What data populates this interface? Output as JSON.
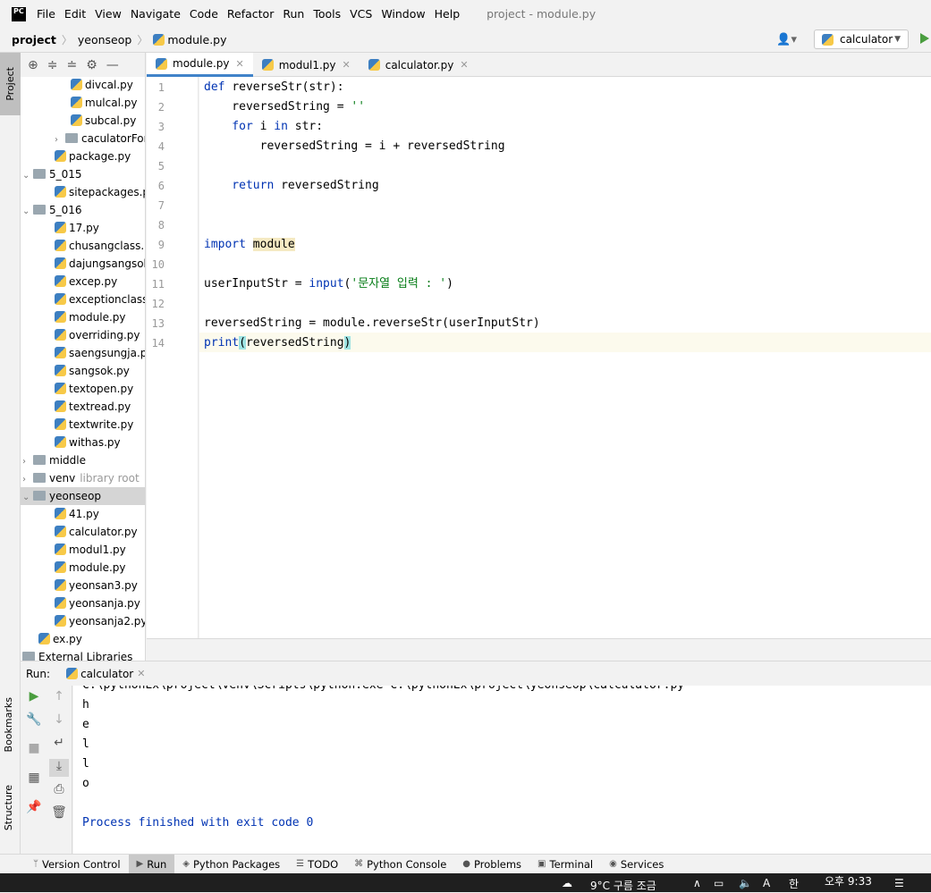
{
  "menubar": {
    "logo": "PC",
    "items": [
      "File",
      "Edit",
      "View",
      "Navigate",
      "Code",
      "Refactor",
      "Run",
      "Tools",
      "VCS",
      "Window",
      "Help"
    ],
    "window_title": "project - module.py"
  },
  "navbar": {
    "crumbs": [
      "project",
      "yeonseop",
      "module.py"
    ],
    "run_config": "calculator"
  },
  "sidebar": {
    "project_tab": "Project",
    "bookmarks_tab": "Bookmarks",
    "structure_tab": "Structure"
  },
  "tree": [
    {
      "name": "divcal.py",
      "type": "py",
      "indent": 3
    },
    {
      "name": "mulcal.py",
      "type": "py",
      "indent": 3
    },
    {
      "name": "subcal.py",
      "type": "py",
      "indent": 3
    },
    {
      "name": "caculatorForInt",
      "type": "folder",
      "indent": 2,
      "arrow": "›"
    },
    {
      "name": "package.py",
      "type": "py",
      "indent": 2
    },
    {
      "name": "5_015",
      "type": "folder",
      "indent": 0,
      "arrow": "⌄"
    },
    {
      "name": "sitepackages.py",
      "type": "py",
      "indent": 2
    },
    {
      "name": "5_016",
      "type": "folder",
      "indent": 0,
      "arrow": "⌄"
    },
    {
      "name": "17.py",
      "type": "py",
      "indent": 2
    },
    {
      "name": "chusangclass.py",
      "type": "py",
      "indent": 2
    },
    {
      "name": "dajungsangsok.py",
      "type": "py",
      "indent": 2
    },
    {
      "name": "excep.py",
      "type": "py",
      "indent": 2
    },
    {
      "name": "exceptionclass.py",
      "type": "py",
      "indent": 2
    },
    {
      "name": "module.py",
      "type": "py",
      "indent": 2
    },
    {
      "name": "overriding.py",
      "type": "py",
      "indent": 2
    },
    {
      "name": "saengsungja.py",
      "type": "py",
      "indent": 2
    },
    {
      "name": "sangsok.py",
      "type": "py",
      "indent": 2
    },
    {
      "name": "textopen.py",
      "type": "py",
      "indent": 2
    },
    {
      "name": "textread.py",
      "type": "py",
      "indent": 2
    },
    {
      "name": "textwrite.py",
      "type": "py",
      "indent": 2
    },
    {
      "name": "withas.py",
      "type": "py",
      "indent": 2
    },
    {
      "name": "middle",
      "type": "folder",
      "indent": 0,
      "arrow": "›"
    },
    {
      "name": "venv",
      "type": "folder",
      "indent": 0,
      "arrow": "›",
      "suffix": "library root"
    },
    {
      "name": "yeonseop",
      "type": "folder",
      "indent": 0,
      "arrow": "⌄",
      "selected": true
    },
    {
      "name": "41.py",
      "type": "py",
      "indent": 2
    },
    {
      "name": "calculator.py",
      "type": "py",
      "indent": 2
    },
    {
      "name": "modul1.py",
      "type": "py",
      "indent": 2
    },
    {
      "name": "module.py",
      "type": "py",
      "indent": 2
    },
    {
      "name": "yeonsan3.py",
      "type": "py",
      "indent": 2
    },
    {
      "name": "yeonsanja.py",
      "type": "py",
      "indent": 2
    },
    {
      "name": "yeonsanja2.py",
      "type": "py",
      "indent": 2
    },
    {
      "name": "ex.py",
      "type": "py",
      "indent": 1
    },
    {
      "name": "External Libraries",
      "type": "lib",
      "indent": 0
    }
  ],
  "editor": {
    "tabs": [
      {
        "label": "module.py",
        "active": true
      },
      {
        "label": "modul1.py",
        "active": false
      },
      {
        "label": "calculator.py",
        "active": false
      }
    ],
    "line_numbers": [
      "1",
      "2",
      "3",
      "4",
      "5",
      "6",
      "7",
      "8",
      "9",
      "10",
      "11",
      "12",
      "13",
      "14"
    ],
    "lines": [
      [
        [
          "kw",
          "def "
        ],
        [
          "fn",
          "reverseStr"
        ],
        [
          "p",
          "(str):"
        ]
      ],
      [
        [
          "p",
          "    reversedString = "
        ],
        [
          "str",
          "''"
        ]
      ],
      [
        [
          "kw",
          "    for "
        ],
        [
          "p",
          "i "
        ],
        [
          "kw",
          "in "
        ],
        [
          "p",
          "str:"
        ]
      ],
      [
        [
          "p",
          "        reversedString = i + reversedString"
        ]
      ],
      [
        [
          "p",
          ""
        ]
      ],
      [
        [
          "kw",
          "    return "
        ],
        [
          "p",
          "reversedString"
        ]
      ],
      [
        [
          "p",
          ""
        ]
      ],
      [
        [
          "p",
          ""
        ]
      ],
      [
        [
          "kw",
          "import "
        ],
        [
          "mod",
          "module"
        ]
      ],
      [
        [
          "p",
          ""
        ]
      ],
      [
        [
          "p",
          "userInputStr = "
        ],
        [
          "kw",
          "input"
        ],
        [
          "p",
          "("
        ],
        [
          "str",
          "'문자열 입력 : '"
        ],
        [
          "p",
          ")"
        ]
      ],
      [
        [
          "p",
          ""
        ]
      ],
      [
        [
          "p",
          "reversedString = module.reverseStr(userInputStr)"
        ]
      ],
      [
        [
          "kw",
          "print"
        ],
        [
          "hp",
          "("
        ],
        [
          "p",
          "reversedString"
        ],
        [
          "hp",
          ")"
        ]
      ]
    ]
  },
  "run": {
    "label": "Run:",
    "tab": "calculator",
    "output": [
      "C:\\pythonEx\\project\\venv\\Scripts\\python.exe C:\\pythonEx\\project\\yeonseop\\calculator.py",
      "h",
      "e",
      "l",
      "l",
      "o",
      "",
      "Process finished with exit code 0"
    ]
  },
  "statusbar": {
    "items": [
      {
        "icon": "version-control-icon",
        "label": "Version Control"
      },
      {
        "icon": "run-icon",
        "label": "Run",
        "active": true
      },
      {
        "icon": "python-packages-icon",
        "label": "Python Packages"
      },
      {
        "icon": "todo-icon",
        "label": "TODO"
      },
      {
        "icon": "python-console-icon",
        "label": "Python Console"
      },
      {
        "icon": "problems-icon",
        "label": "Problems"
      },
      {
        "icon": "terminal-icon",
        "label": "Terminal"
      },
      {
        "icon": "services-icon",
        "label": "Services"
      }
    ]
  },
  "taskbar": {
    "weather": "9°C  구름 조금",
    "ime": "한",
    "time": "오후 9:33"
  },
  "colors": {
    "keyword": "#0033b3",
    "string": "#067d17",
    "accent": "#4083c9",
    "run_green": "#4a9d3f"
  }
}
